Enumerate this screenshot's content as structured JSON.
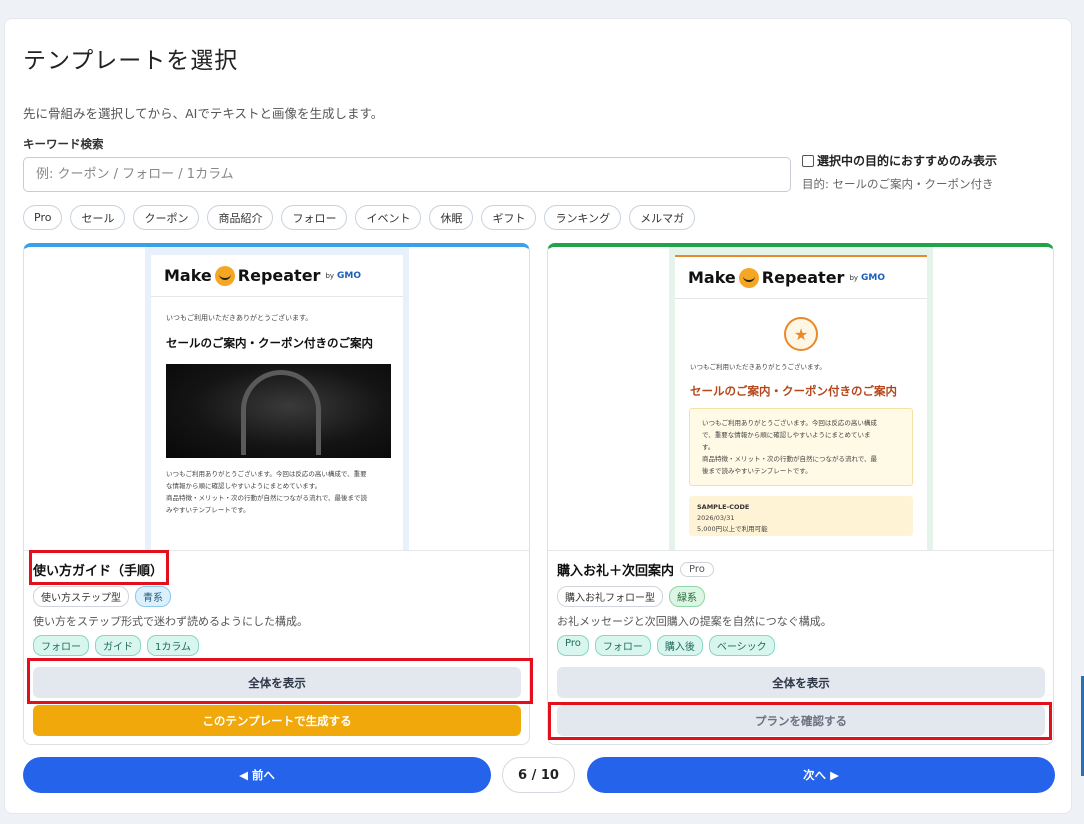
{
  "header": {
    "title": "テンプレートを選択",
    "subtitle": "先に骨組みを選択してから、AIでテキストと画像を生成します。"
  },
  "search": {
    "label": "キーワード検索",
    "placeholder": "例: クーポン / フォロー / 1カラム",
    "value": ""
  },
  "filter": {
    "recommend_label": "選択中の目的におすすめのみ表示",
    "recommend_checked": false,
    "purpose_text": "目的: セールのご案内・クーポン付き"
  },
  "chips": [
    "Pro",
    "セール",
    "クーポン",
    "商品紹介",
    "フォロー",
    "イベント",
    "休眠",
    "ギフト",
    "ランキング",
    "メルマガ"
  ],
  "cards": [
    {
      "accent": "#3aa0ea",
      "preview": {
        "logo": "Make",
        "logo2": "Repeater",
        "logo_by": "by",
        "logo_gmo": "GMO",
        "greeting": "いつもご利用いただきありがとうございます。",
        "heading": "セールのご案内・クーポン付きのご案内",
        "body1": "いつもご利用ありがとうございます。今回は反応の高い構成で、重要",
        "body2": "な情報から順に確認しやすいようにまとめています。",
        "body3": "商品特徴・メリット・次の行動が自然につながる流れで、最後まで読",
        "body4": "みやすいテンプレートです。"
      },
      "name": "使い方ガイド（手順）",
      "type_tag": "使い方ステップ型",
      "color_tag": "青系",
      "description": "使い方をステップ形式で迷わず読めるようにした構成。",
      "keywords": [
        "フォロー",
        "ガイド",
        "1カラム"
      ],
      "view_button": "全体を表示",
      "action_button": "このテンプレートで生成する"
    },
    {
      "accent": "#22a34a",
      "preview": {
        "logo": "Make",
        "logo2": "Repeater",
        "logo_by": "by",
        "logo_gmo": "GMO",
        "star": "★",
        "greeting": "いつもご利用いただきありがとうございます。",
        "heading": "セールのご案内・クーポン付きのご案内",
        "box1": "いつもご利用ありがとうございます。今回は反応の高い構成",
        "box2": "で、重要な情報から順に確認しやすいようにまとめていま",
        "box3": "す。",
        "box4": "商品特徴・メリット・次の行動が自然につながる流れで、最",
        "box5": "後まで読みやすいテンプレートです。",
        "coupon_code": "SAMPLE-CODE",
        "coupon_date": "2026/03/31",
        "coupon_cond": "5,000円以上で利用可能"
      },
      "name": "購入お礼＋次回案内",
      "pro_badge": "Pro",
      "type_tag": "購入お礼フォロー型",
      "color_tag": "緑系",
      "description": "お礼メッセージと次回購入の提案を自然につなぐ構成。",
      "keywords": [
        "Pro",
        "フォロー",
        "購入後",
        "ベーシック"
      ],
      "view_button": "全体を表示",
      "action_button": "プランを確認する"
    }
  ],
  "pagination": {
    "prev": "◀ 前へ",
    "page": "6 / 10",
    "next": "次へ ▶"
  },
  "colors": {
    "primary": "#2563eb",
    "generate": "#f0a80a",
    "highlight": "#e2101d"
  }
}
